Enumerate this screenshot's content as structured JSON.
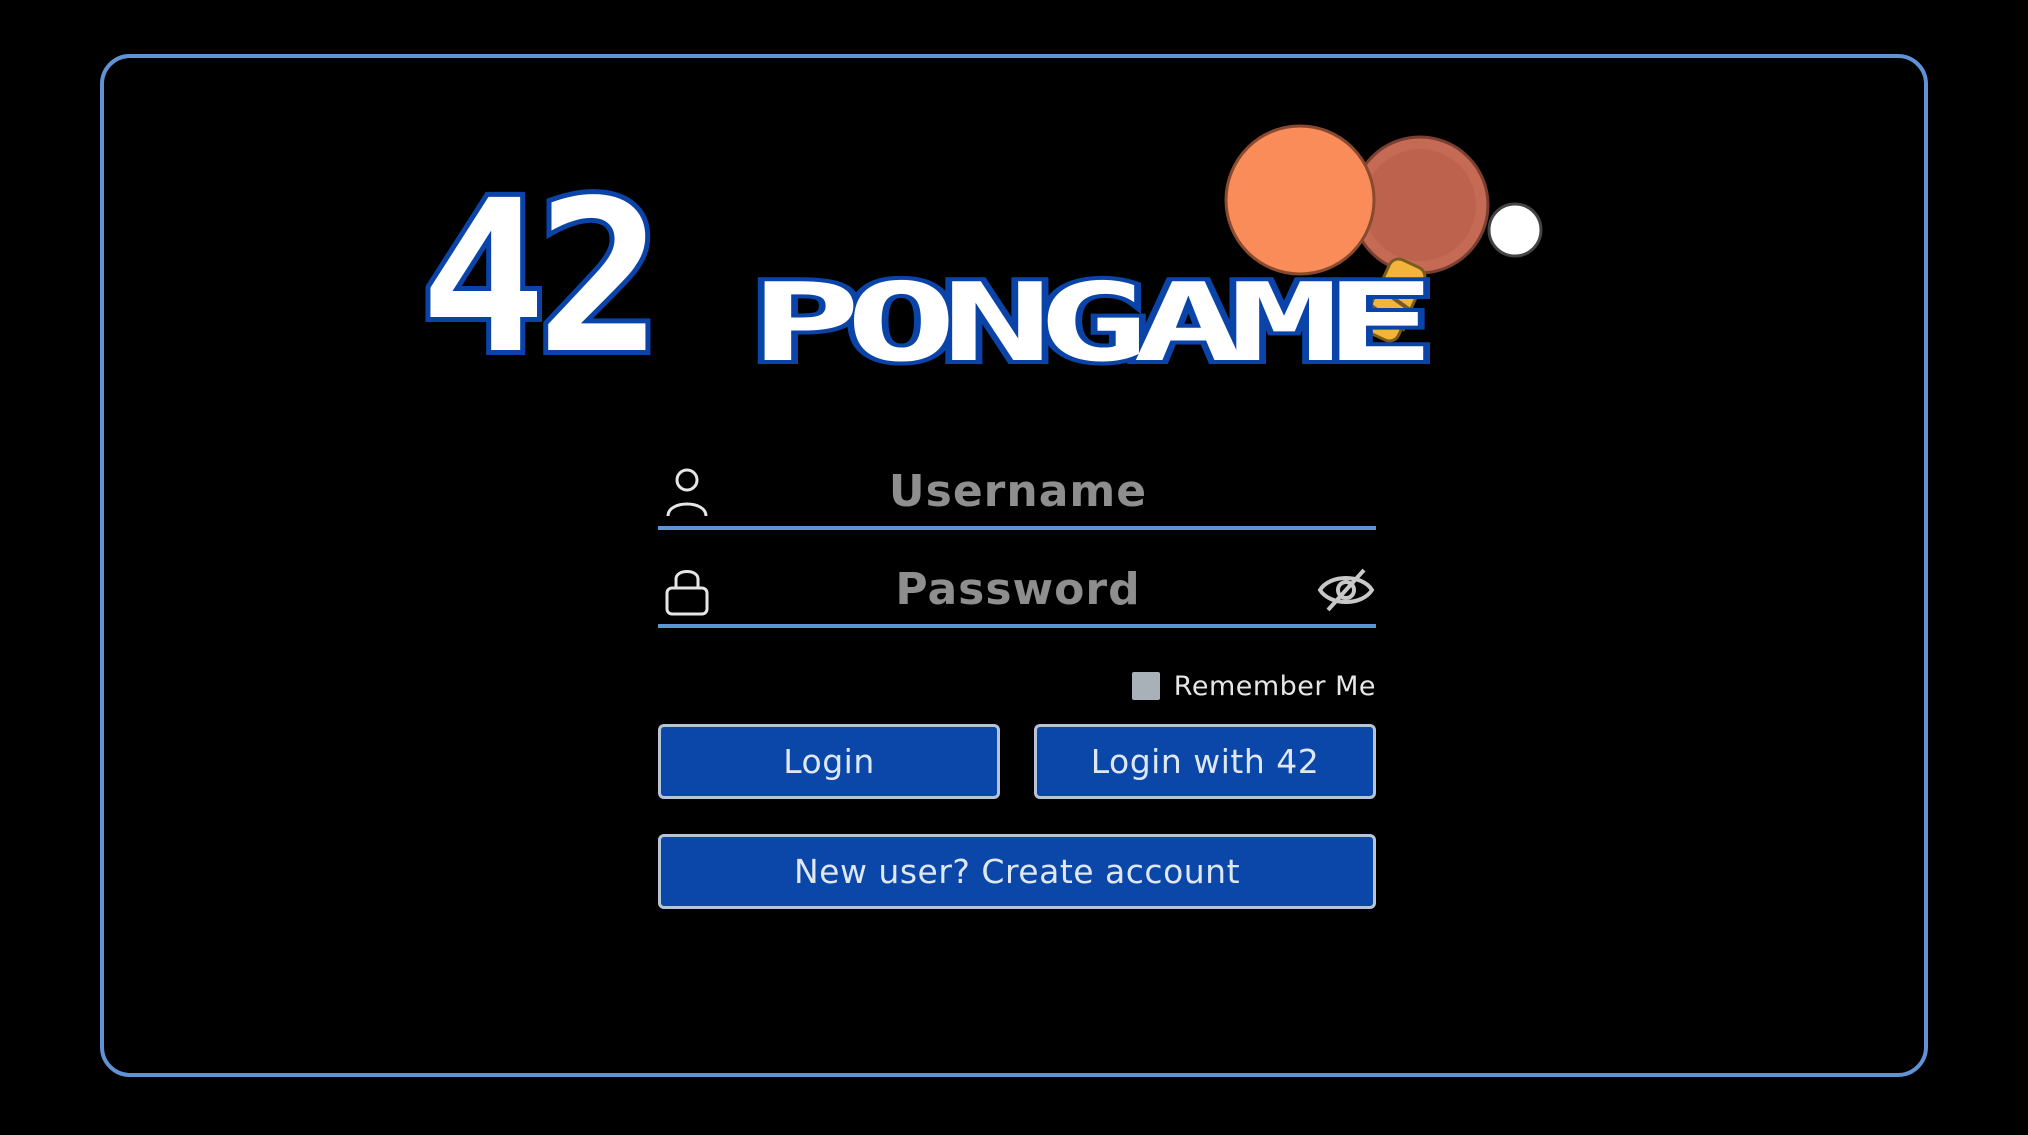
{
  "logo": {
    "number": "42",
    "word": "PONGAME",
    "mascot_icon": "ping-pong-paddle-icon"
  },
  "form": {
    "username_placeholder": "Username",
    "password_placeholder": "Password",
    "username_icon": "user-icon",
    "password_icon": "lock-icon",
    "visibility_icon": "eye-slash-icon",
    "remember_label": "Remember Me",
    "remember_checked": false
  },
  "buttons": {
    "login": "Login",
    "login_42": "Login with 42",
    "create_account": "New user? Create account"
  },
  "colors": {
    "background": "#000000",
    "frame_border": "#5f93d6",
    "button_fill": "#0a47a8",
    "logo_outline": "#0b44a8",
    "paddle_front": "#fa8c5a",
    "paddle_back": "#c46a55"
  }
}
